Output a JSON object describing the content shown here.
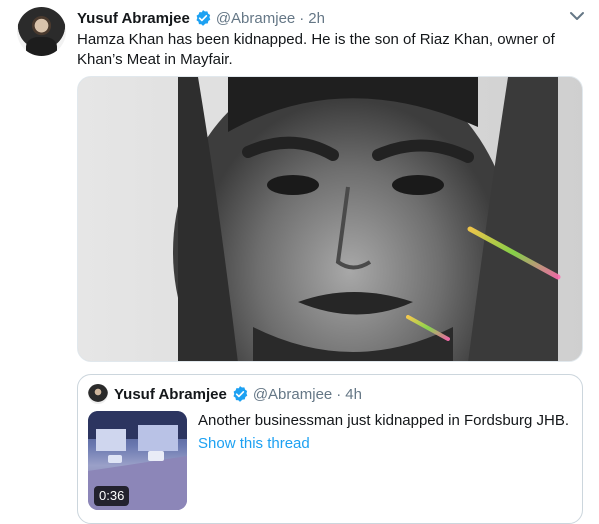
{
  "tweet": {
    "author_name": "Yusuf Abramjee",
    "author_handle": "@Abramjee",
    "separator": "·",
    "time": "2h",
    "text": "Hamza Khan has been kidnapped. He is the son of Riaz Khan, owner of Khan’s Meat in Mayfair."
  },
  "quoted": {
    "author_name": "Yusuf Abramjee",
    "author_handle": "@Abramjee",
    "separator": "·",
    "time": "4h",
    "text": "Another businessman just kidnapped in Fordsburg JHB.",
    "link": "Show this thread",
    "video_duration": "0:36"
  },
  "colors": {
    "accent": "#1da1f2",
    "muted": "#657786",
    "verified": "#1da1f2"
  },
  "icons": [
    "verified-badge-icon",
    "chevron-down-icon"
  ]
}
